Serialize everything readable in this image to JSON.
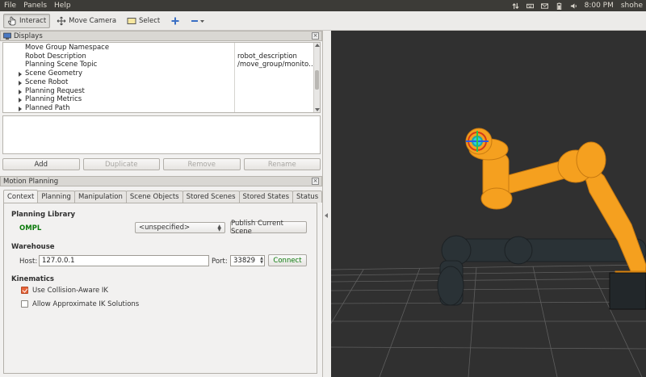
{
  "menubar": {
    "items": [
      "File",
      "Panels",
      "Help"
    ],
    "clock": "8:00 PM",
    "user": "shohe",
    "tray_icons": [
      "network-arrows-icon",
      "keyboard-icon",
      "mail-icon",
      "battery-icon",
      "volume-icon"
    ]
  },
  "toolbar": {
    "interact": "Interact",
    "move_camera": "Move Camera",
    "select": "Select"
  },
  "displays": {
    "title": "Displays",
    "rows": [
      {
        "label": "Move Group Namespace",
        "value": "",
        "expandable": false
      },
      {
        "label": "Robot Description",
        "value": "robot_description",
        "expandable": false
      },
      {
        "label": "Planning Scene Topic",
        "value": "/move_group/monito…",
        "expandable": false
      },
      {
        "label": "Scene Geometry",
        "value": "",
        "expandable": true
      },
      {
        "label": "Scene Robot",
        "value": "",
        "expandable": true
      },
      {
        "label": "Planning Request",
        "value": "",
        "expandable": true
      },
      {
        "label": "Planning Metrics",
        "value": "",
        "expandable": true
      },
      {
        "label": "Planned Path",
        "value": "",
        "expandable": true
      }
    ],
    "buttons": {
      "add": "Add",
      "duplicate": "Duplicate",
      "remove": "Remove",
      "rename": "Rename"
    }
  },
  "motion_planning": {
    "title": "Motion Planning",
    "tabs": [
      "Context",
      "Planning",
      "Manipulation",
      "Scene Objects",
      "Stored Scenes",
      "Stored States",
      "Status"
    ],
    "active_tab": "Context",
    "planning_library": {
      "title": "Planning Library",
      "library": "OMPL",
      "planner": "<unspecified>",
      "publish_button": "Publish Current Scene"
    },
    "warehouse": {
      "title": "Warehouse",
      "host_label": "Host:",
      "host_value": "127.0.0.1",
      "port_label": "Port:",
      "port_value": "33829",
      "connect_button": "Connect"
    },
    "kinematics": {
      "title": "Kinematics",
      "collision_aware_ik": {
        "label": "Use Collision-Aware IK",
        "checked": true
      },
      "approx_ik": {
        "label": "Allow Approximate IK Solutions",
        "checked": false
      }
    }
  },
  "colors": {
    "robot_orange": "#f5a01f",
    "viewport_bg": "#303030",
    "ompl_green": "#0b7a0b",
    "checkbox_accent": "#e7643a"
  }
}
